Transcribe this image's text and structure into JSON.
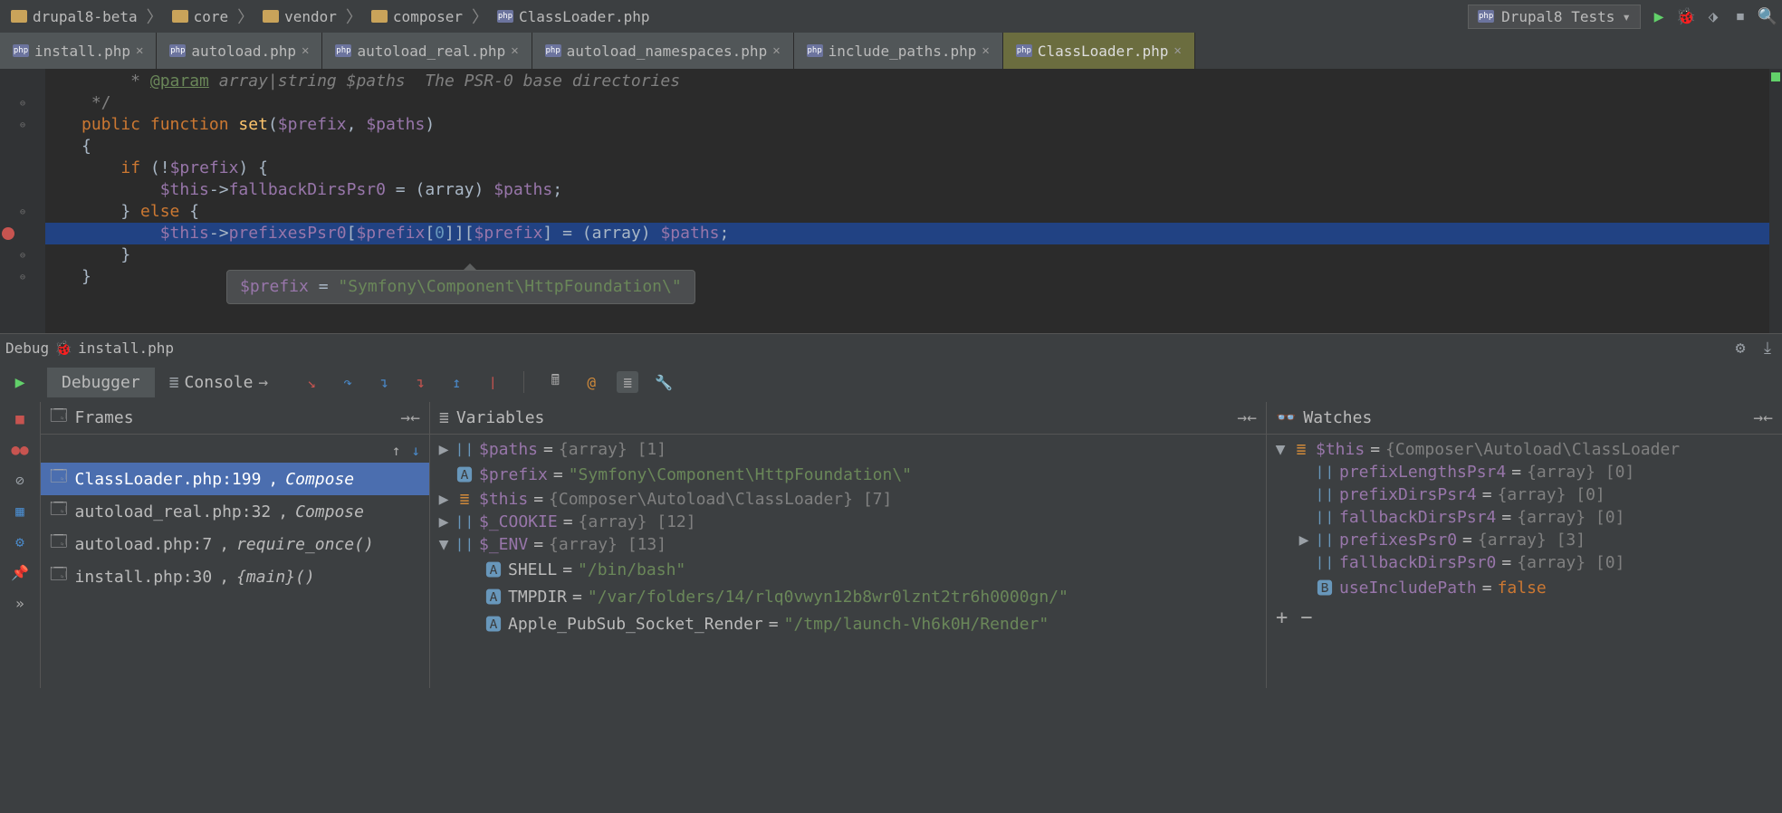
{
  "breadcrumbs": [
    {
      "type": "folder",
      "label": "drupal8-beta"
    },
    {
      "type": "folder",
      "label": "core"
    },
    {
      "type": "folder",
      "label": "vendor"
    },
    {
      "type": "folder",
      "label": "composer"
    },
    {
      "type": "php",
      "label": "ClassLoader.php"
    }
  ],
  "run_config": "Drupal8 Tests",
  "tabs": [
    {
      "label": "install.php",
      "active": false
    },
    {
      "label": "autoload.php",
      "active": false
    },
    {
      "label": "autoload_real.php",
      "active": false
    },
    {
      "label": "autoload_namespaces.php",
      "active": false
    },
    {
      "label": "include_paths.php",
      "active": false
    },
    {
      "label": "ClassLoader.php",
      "active": true
    }
  ],
  "code": {
    "doc_tag": "@param",
    "doc_line": " array|string $paths  The PSR-0 base directories",
    "doc_close": " */",
    "kw_public": "public",
    "kw_function": "function",
    "fn_name": "set",
    "params_open": "(",
    "var_prefix": "$prefix",
    "comma": ", ",
    "var_paths": "$paths",
    "params_close": ")",
    "brace_open": "{",
    "kw_if": "if",
    "cond_open": " (!",
    "cond_close": ") {",
    "this": "$this",
    "arrow": "->",
    "prop_fallback": "fallbackDirsPsr0",
    "assign": " = ",
    "cast": "(array) ",
    "semi": ";",
    "brace_close": "}",
    "kw_else": "else",
    "prop_prefixes": "prefixesPsr0",
    "br_open": "[",
    "br_close": "]",
    "zero": "0",
    "inner_brace_close": "}",
    "outer_brace_close": "}"
  },
  "tooltip": {
    "var": "$prefix",
    "eq": " = ",
    "val": "\"Symfony\\Component\\HttpFoundation\\\""
  },
  "debug_title_prefix": "Debug",
  "debug_title_file": "install.php",
  "sub_tabs": {
    "debugger": "Debugger",
    "console": "Console"
  },
  "panels": {
    "frames": "Frames",
    "variables": "Variables",
    "watches": "Watches"
  },
  "frames": [
    {
      "file": "ClassLoader.php:199",
      "ctx": "Compose",
      "selected": true
    },
    {
      "file": "autoload_real.php:32",
      "ctx": "Compose",
      "selected": false
    },
    {
      "file": "autoload.php:7",
      "ctx": "require_once()",
      "selected": false
    },
    {
      "file": "install.php:30",
      "ctx": "{main}()",
      "selected": false
    }
  ],
  "variables": [
    {
      "exp": "▶",
      "name": "$paths",
      "val": "{array} [1]",
      "kind": "arr"
    },
    {
      "exp": "",
      "name": "$prefix",
      "val": "\"Symfony\\Component\\HttpFoundation\\\"",
      "kind": "str"
    },
    {
      "exp": "▶",
      "name": "$this",
      "val": "{Composer\\Autoload\\ClassLoader} [7]",
      "kind": "obj"
    },
    {
      "exp": "▶",
      "name": "$_COOKIE",
      "val": "{array} [12]",
      "kind": "arr"
    },
    {
      "exp": "▼",
      "name": "$_ENV",
      "val": "{array} [13]",
      "kind": "arr",
      "children": [
        {
          "name": "SHELL",
          "val": "\"/bin/bash\""
        },
        {
          "name": "TMPDIR",
          "val": "\"/var/folders/14/rlq0vwyn12b8wr0lznt2tr6h0000gn/\""
        },
        {
          "name": "Apple_PubSub_Socket_Render",
          "val": "\"/tmp/launch-Vh6k0H/Render\""
        }
      ]
    }
  ],
  "watches": {
    "root": {
      "name": "$this",
      "val": "{Composer\\Autoload\\ClassLoader"
    },
    "children": [
      {
        "name": "prefixLengthsPsr4",
        "val": "{array} [0]",
        "kind": "arr"
      },
      {
        "name": "prefixDirsPsr4",
        "val": "{array} [0]",
        "kind": "arr"
      },
      {
        "name": "fallbackDirsPsr4",
        "val": "{array} [0]",
        "kind": "arr"
      },
      {
        "name": "prefixesPsr0",
        "val": "{array} [3]",
        "exp": "▶",
        "kind": "arr"
      },
      {
        "name": "fallbackDirsPsr0",
        "val": "{array} [0]",
        "kind": "arr"
      },
      {
        "name": "useIncludePath",
        "val": "false",
        "kind": "bool"
      }
    ]
  }
}
